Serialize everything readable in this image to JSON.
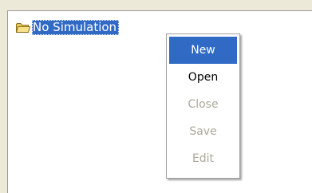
{
  "tree": {
    "root": {
      "icon": "folder-icon",
      "label": "No Simulation"
    }
  },
  "context_menu": {
    "items": [
      {
        "label": "New",
        "state": "highlighted"
      },
      {
        "label": "Open",
        "state": "enabled"
      },
      {
        "label": "Close",
        "state": "disabled"
      },
      {
        "label": "Save",
        "state": "disabled"
      },
      {
        "label": "Edit",
        "state": "disabled"
      }
    ]
  },
  "colors": {
    "selection": "#316ac5",
    "disabled_text": "#aca899",
    "window_background": "#ece9d8"
  }
}
